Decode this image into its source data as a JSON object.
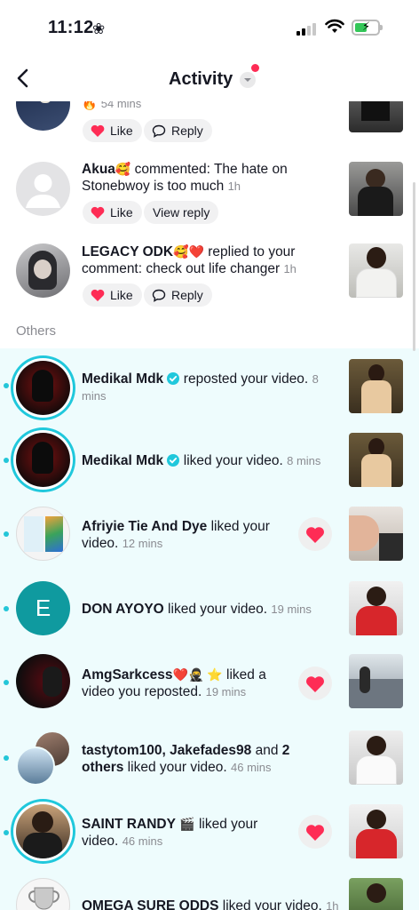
{
  "status": {
    "time": "11:12"
  },
  "header": {
    "title": "Activity"
  },
  "rows": [
    {
      "time": "54 mins",
      "like": "Like",
      "action": "Reply"
    },
    {
      "user": "Akua",
      "emoji": "🥰",
      "text": " commented: The hate on Stonebwoy is too much",
      "time": "1h",
      "like": "Like",
      "action": "View reply"
    },
    {
      "user": "LEGACY ODK",
      "emoji": "🥰❤️",
      "text": " replied to your comment: check out life changer",
      "time": "1h",
      "like": "Like",
      "action": "Reply"
    }
  ],
  "section": "Others",
  "others": [
    {
      "user": "Medikal Mdk",
      "text": " reposted your video.",
      "time": "8 mins"
    },
    {
      "user": "Medikal Mdk",
      "text": " liked your video.",
      "time": "8 mins"
    },
    {
      "user": "Afriyie Tie And Dye",
      "text": " liked your video.",
      "time": "12 mins"
    },
    {
      "user": "DON AYOYO",
      "text": " liked your video.",
      "time": "19 mins",
      "avatar_letter": "E"
    },
    {
      "user": "AmgSarkcess",
      "emoji": "❤️🥷 ⭐",
      "text": " liked a video you reposted.",
      "time": "19 mins"
    },
    {
      "user": "tastytom100, Jakefades98",
      "mid": " and ",
      "bold2": "2 others",
      "text": " liked your video.",
      "time": "46 mins"
    },
    {
      "user": "SAINT RANDY",
      "emoji": "🎬",
      "text": " liked your video.",
      "time": "46 mins"
    },
    {
      "user": "OMEGA SURE ODDS",
      "text": " liked your video.",
      "time": "1h"
    }
  ],
  "colors": {
    "accent": "#20c8dc",
    "like_red": "#fe2c55",
    "new_bg": "#eefcfd"
  }
}
